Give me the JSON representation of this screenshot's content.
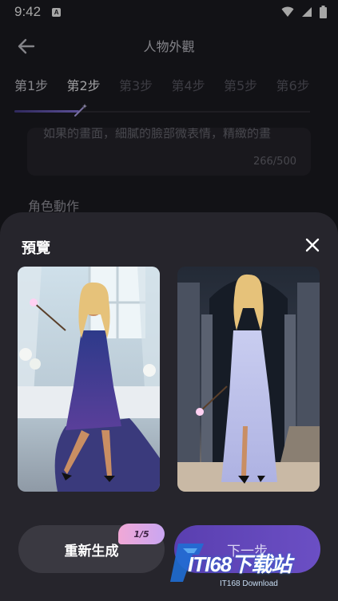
{
  "status_bar": {
    "time": "9:42",
    "notification_letter": "A",
    "icons": [
      "wifi-icon",
      "signal-icon",
      "battery-icon"
    ]
  },
  "header": {
    "title": "人物外觀",
    "back_icon": "arrow-left-icon"
  },
  "steps": [
    {
      "label": "第1步",
      "state": "done"
    },
    {
      "label": "第2步",
      "state": "active"
    },
    {
      "label": "第3步",
      "state": "pending"
    },
    {
      "label": "第4步",
      "state": "pending"
    },
    {
      "label": "第5步",
      "state": "pending"
    },
    {
      "label": "第6步",
      "state": "pending"
    }
  ],
  "step_progress": 0.22,
  "background_form": {
    "textarea_partial_text": "如果的畫面，細膩的臉部微表情，精緻的畫",
    "char_count": "266/500",
    "section_label": "角色動作"
  },
  "preview_sheet": {
    "title": "預覽",
    "close_icon": "close-icon",
    "images": [
      {
        "name": "preview-image-1",
        "description_icon": "image"
      },
      {
        "name": "preview-image-2",
        "description_icon": "image"
      }
    ],
    "regenerate_label": "重新生成",
    "regenerate_count": "1/5",
    "next_label": "下一步"
  },
  "watermark": {
    "logo_text": "ITI68下载站",
    "subtext": "IT168 Download"
  },
  "colors": {
    "background": "#1d1c22",
    "sheet": "#26252c",
    "accent": "#6b4fc4",
    "badge_gradient_start": "#f1a8d6",
    "badge_gradient_end": "#c9a6f2"
  }
}
